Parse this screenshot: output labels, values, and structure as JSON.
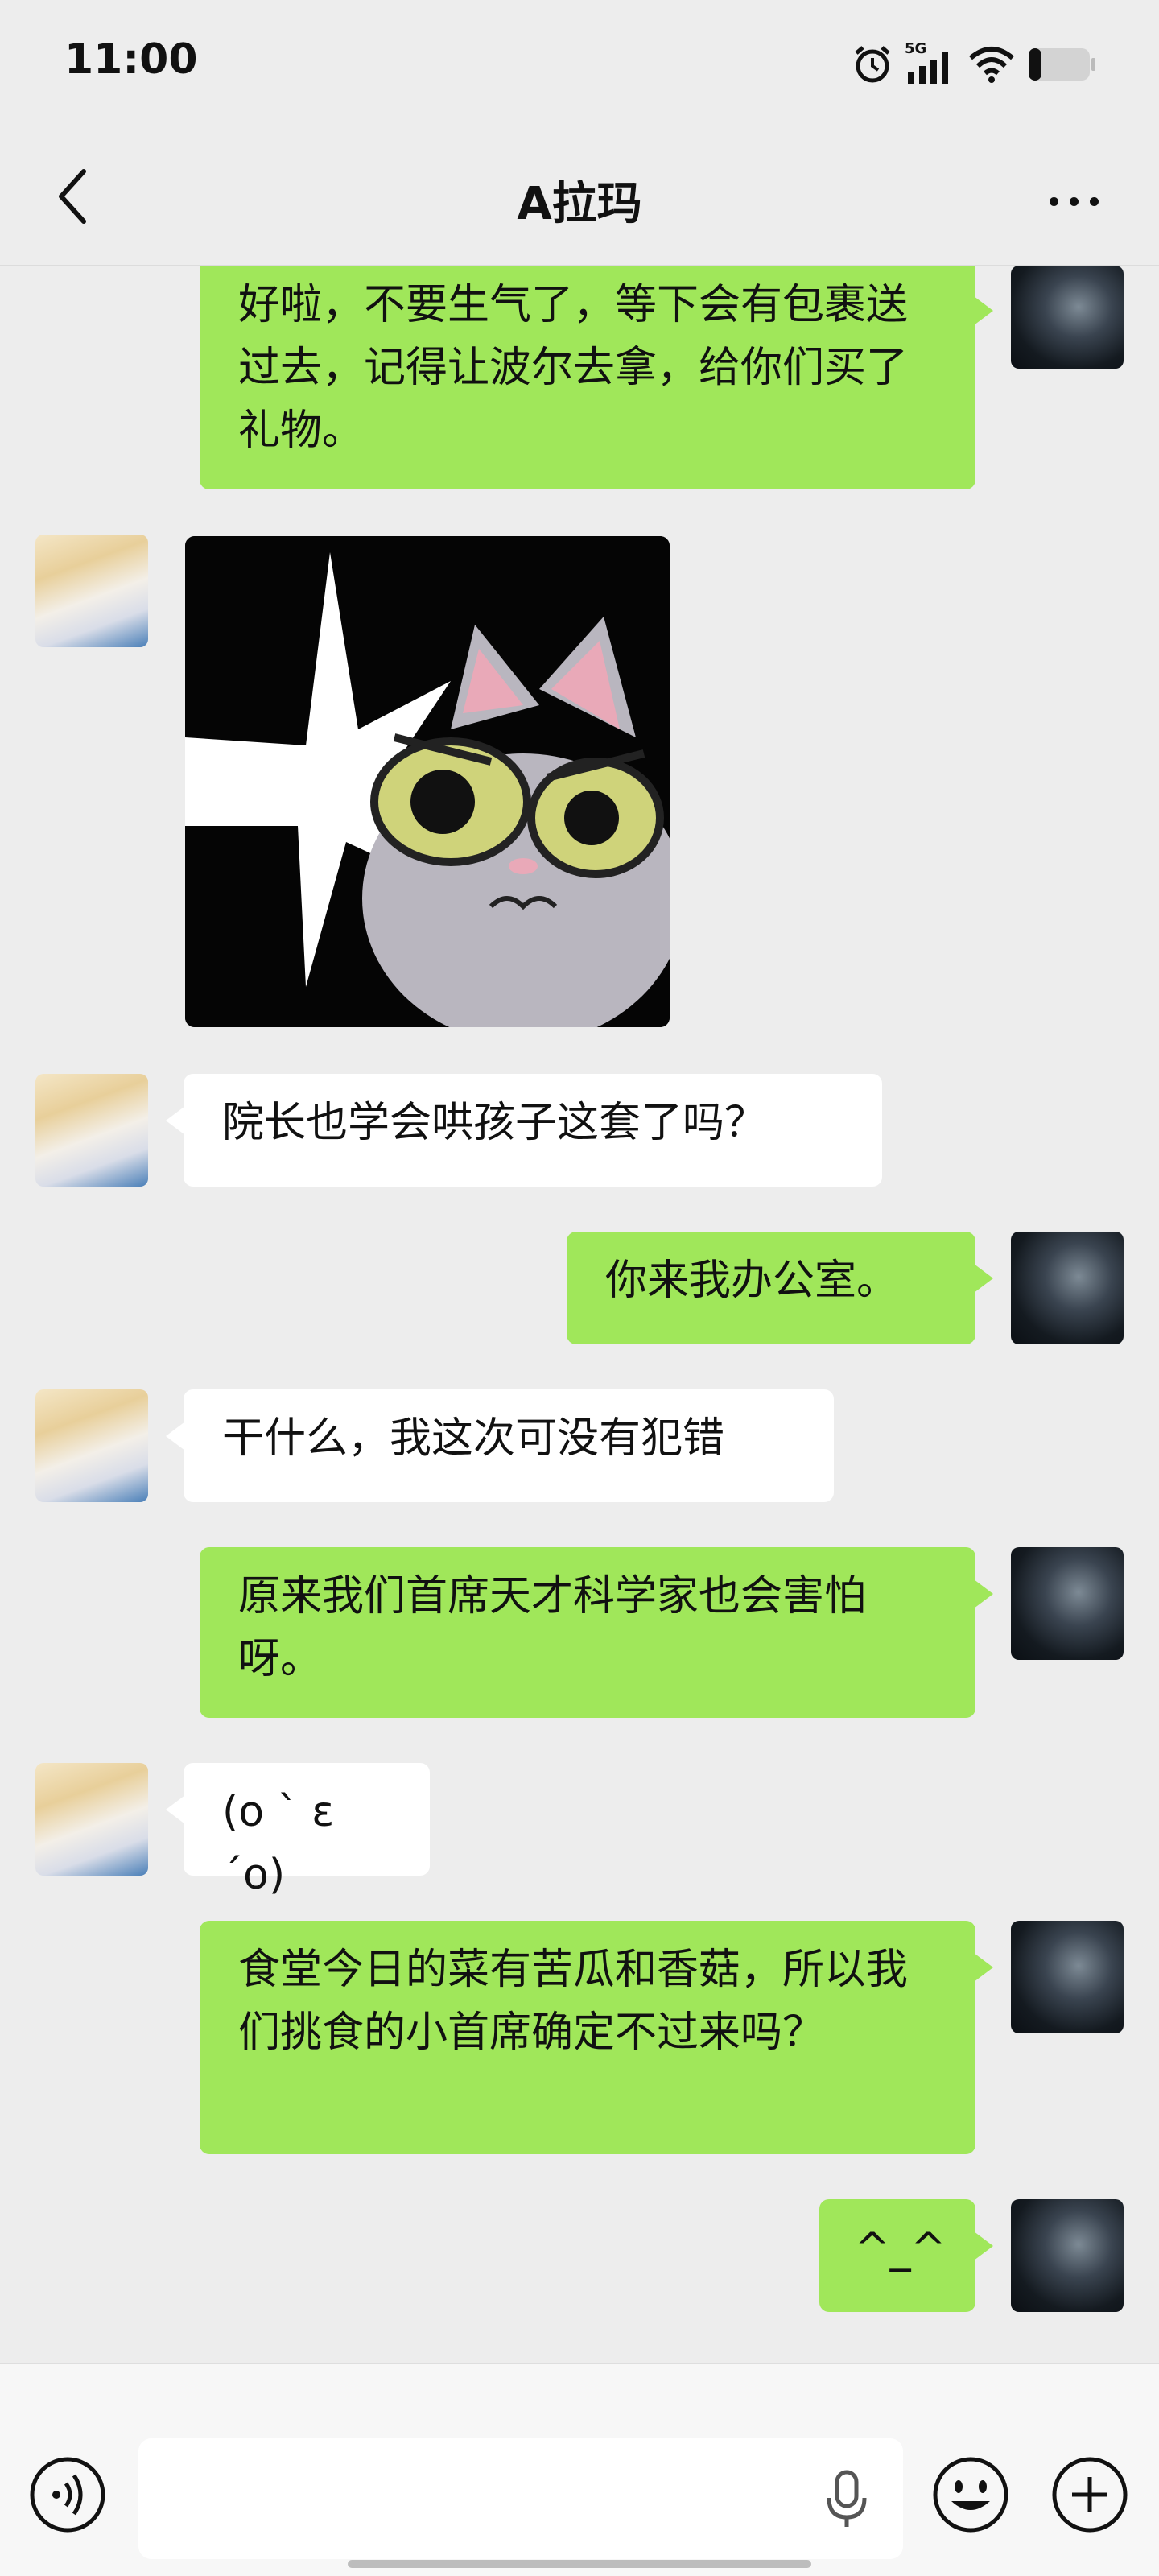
{
  "status_bar": {
    "time": "11:00",
    "network_label": "5G"
  },
  "header": {
    "title": "A拉玛",
    "back_icon": "chevron-left-icon",
    "more_icon": "more-dots-icon"
  },
  "messages": [
    {
      "from": "me",
      "type": "text",
      "text": "好啦，不要生气了，等下会有包裹送过去，记得让波尔去拿，给你们买了礼物。"
    },
    {
      "from": "them",
      "type": "sticker",
      "sticker": "angry-gray-cat-sticker"
    },
    {
      "from": "them",
      "type": "text",
      "text": "院长也学会哄孩子这套了吗？"
    },
    {
      "from": "me",
      "type": "text",
      "text": "你来我办公室。"
    },
    {
      "from": "them",
      "type": "text",
      "text": "干什么，我这次可没有犯错"
    },
    {
      "from": "me",
      "type": "text",
      "text": "原来我们首席天才科学家也会害怕呀。"
    },
    {
      "from": "them",
      "type": "text",
      "text": "(o ` ε´o)"
    },
    {
      "from": "me",
      "type": "text",
      "text": "食堂今日的菜有苦瓜和香菇，所以我们挑食的小首席确定不过来吗？"
    },
    {
      "from": "me",
      "type": "text",
      "text": "^_^"
    }
  ],
  "input_bar": {
    "value": "",
    "voice_icon": "voice-mode-icon",
    "mic_icon": "microphone-icon",
    "emoji_icon": "emoji-icon",
    "plus_icon": "plus-icon"
  },
  "colors": {
    "background": "#ededed",
    "my_bubble": "#a0e75a",
    "their_bubble": "#ffffff"
  }
}
